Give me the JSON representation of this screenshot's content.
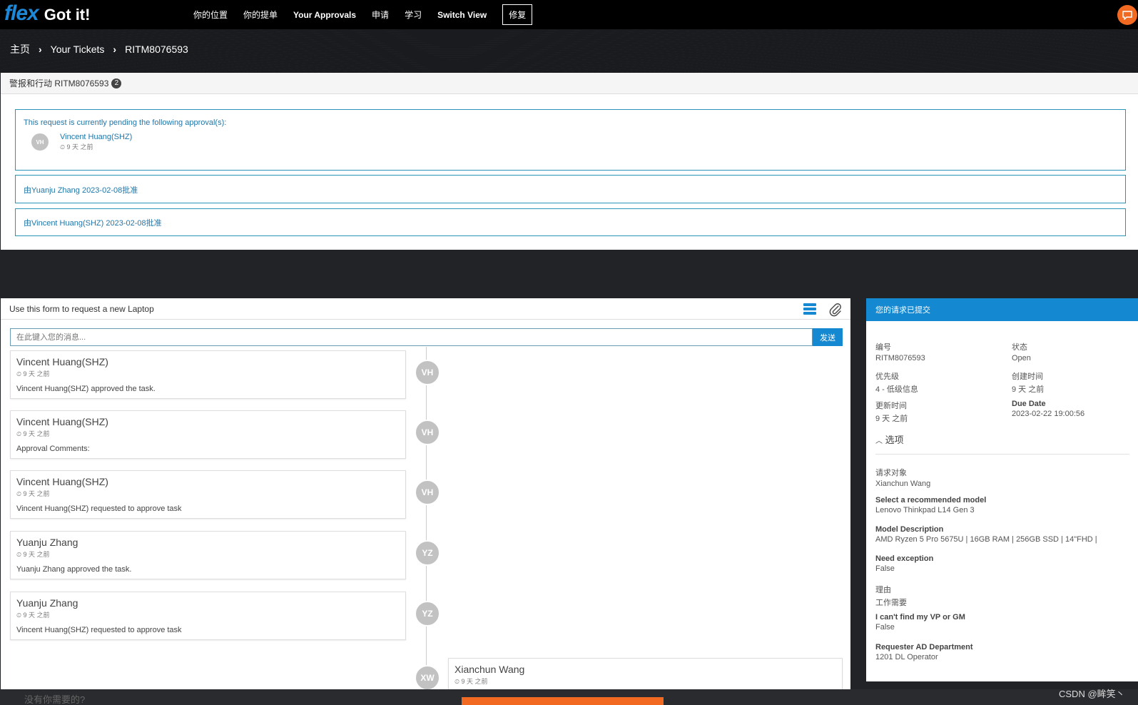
{
  "header": {
    "logo_flex": "flex",
    "logo_title": "Got it!",
    "nav": [
      "你的位置",
      "你的提单",
      "Your Approvals",
      "申请",
      "学习",
      "Switch View"
    ],
    "repair": "修复"
  },
  "breadcrumb": [
    "主页",
    "Your Tickets",
    "RITM8076593"
  ],
  "alerts": {
    "title": "警报和行动 RITM8076593",
    "count": "2",
    "pending_text": "This request is currently pending the following approval(s):",
    "approver_initials": "VH",
    "approver_name": "Vincent Huang(SHZ)",
    "approver_time": "9 天 之前",
    "approved_1": "由Yuanju Zhang 2023-02-08批准",
    "approved_2": "由Vincent Huang(SHZ) 2023-02-08批准"
  },
  "form": {
    "title": "Use this form to request a new Laptop",
    "message_placeholder": "在此键入您的消息...",
    "send": "发送",
    "entries": [
      {
        "name": "Vincent Huang(SHZ)",
        "time": "9 天 之前",
        "body": "Vincent Huang(SHZ) approved the task.",
        "initials": "VH"
      },
      {
        "name": "Vincent Huang(SHZ)",
        "time": "9 天 之前",
        "body": "Approval Comments:",
        "initials": "VH"
      },
      {
        "name": "Vincent Huang(SHZ)",
        "time": "9 天 之前",
        "body": "Vincent Huang(SHZ) requested to approve task",
        "initials": "VH"
      },
      {
        "name": "Yuanju Zhang",
        "time": "9 天 之前",
        "body": "Yuanju Zhang approved the task.",
        "initials": "YZ"
      },
      {
        "name": "Yuanju Zhang",
        "time": "9 天 之前",
        "body": "Vincent Huang(SHZ) requested to approve task",
        "initials": "YZ"
      }
    ],
    "last_entry": {
      "name": "Xianchun Wang",
      "time": "9 天 之前",
      "initials": "XW"
    }
  },
  "side": {
    "title": "您的请求已提交",
    "number_label": "编号",
    "number_value": "RITM8076593",
    "state_label": "状态",
    "state_value": "Open",
    "priority_label": "优先级",
    "priority_value": "4 - 低级信息",
    "created_label": "创建时间",
    "created_value": "9 天 之前",
    "updated_label": "更新时间",
    "updated_value": "9 天 之前",
    "due_label": "Due Date",
    "due_value": "2023-02-22 19:00:56",
    "options_label": "选项",
    "fields": [
      {
        "label": "请求对象",
        "value": "Xianchun Wang",
        "bold": false
      },
      {
        "label": "Select a recommended model",
        "value": "Lenovo Thinkpad L14 Gen 3",
        "bold": true
      },
      {
        "label": "Model Description",
        "value": "AMD Ryzen 5 Pro 5675U | 16GB RAM | 256GB SSD | 14\"FHD |",
        "bold": true
      },
      {
        "label": "Need exception",
        "value": "False",
        "bold": true
      },
      {
        "label": "理由",
        "value": "工作需要",
        "bold": false
      },
      {
        "label": "I can't find my VP or GM",
        "value": "False",
        "bold": true
      },
      {
        "label": "Requester AD Department",
        "value": "1201 DL Operator",
        "bold": true
      }
    ]
  },
  "footer": {
    "question": "没有你需要的?",
    "watermark": "CSDN @眸笑丶"
  }
}
